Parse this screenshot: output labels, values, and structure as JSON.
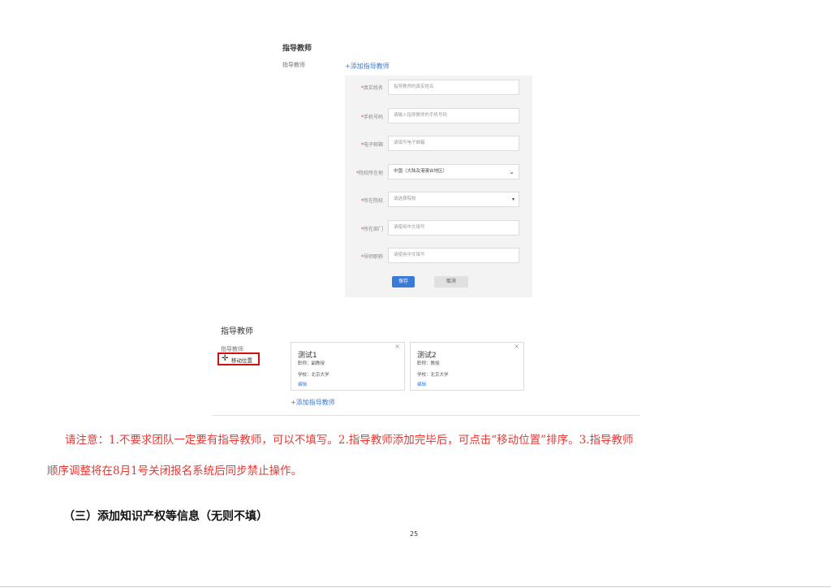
{
  "top": {
    "heading": "指导教师",
    "label": "指导教师",
    "add_link": "+添加指导教师"
  },
  "form": {
    "rows": [
      {
        "label": "真实姓名",
        "placeholder": "指导教师的真实姓名"
      },
      {
        "label": "手机号码",
        "placeholder": "请输入指导教师的手机号码"
      },
      {
        "label": "电子邮箱",
        "placeholder": "请填写电子邮箱"
      },
      {
        "label": "院校所在地",
        "placeholder": "中国（大陆及港澳台地区）"
      },
      {
        "label": "所在院校",
        "placeholder": "请选择院校"
      },
      {
        "label": "所在部门",
        "placeholder": "请使用中文填写"
      },
      {
        "label": "导师职称",
        "placeholder": "请使用中文填写"
      }
    ],
    "required_mark": "*",
    "save": "保存",
    "cancel": "取消"
  },
  "bottom": {
    "heading": "指导教师",
    "label": "指导教师",
    "move": "移动位置",
    "cards": [
      {
        "name": "测试1",
        "title": "职称：副教授",
        "school": "学校：北京大学",
        "edit": "编辑",
        "close": "×"
      },
      {
        "name": "测试2",
        "title": "职称：教授",
        "school": "学校：北京大学",
        "edit": "编辑",
        "close": "×"
      }
    ],
    "add_link": "+添加指导教师"
  },
  "note": {
    "line1": "请注意：1.不要求团队一定要有指导教师，可以不填写。2.指导教师添加完毕后，可点击“移动位置”排序。3.指导教师",
    "line2": "顺序调整将在8月1号关闭报名系统后同步禁止操作。"
  },
  "section_title": "（三）添加知识产权等信息（无则不填）",
  "page_number": "25"
}
